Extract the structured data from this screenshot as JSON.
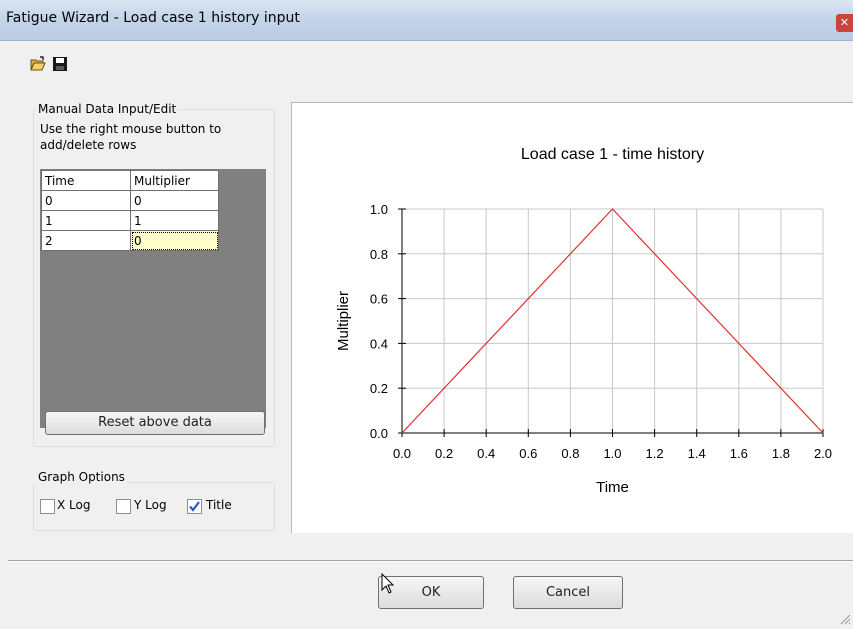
{
  "window": {
    "title": "Fatigue Wizard - Load case 1 history input"
  },
  "toolbar": {
    "icons": [
      "open-folder-icon",
      "save-icon"
    ]
  },
  "manual": {
    "group_label": "Manual Data Input/Edit",
    "hint": "Use the right mouse button to add/delete rows",
    "columns": [
      "Time",
      "Multiplier"
    ],
    "rows": [
      [
        "0",
        "0"
      ],
      [
        "1",
        "1"
      ],
      [
        "2",
        "0"
      ]
    ],
    "reset_label": "Reset above data"
  },
  "graph_options": {
    "group_label": "Graph Options",
    "xlog_label": "X Log",
    "xlog_checked": false,
    "ylog_label": "Y Log",
    "ylog_checked": false,
    "title_label": "Title",
    "title_checked": true
  },
  "chart_data": {
    "type": "line",
    "title": "Load case 1 - time history",
    "xlabel": "Time",
    "ylabel": "Multiplier",
    "xlim": [
      0,
      2
    ],
    "ylim": [
      0,
      1
    ],
    "xticks": [
      "0.0",
      "0.2",
      "0.4",
      "0.6",
      "0.8",
      "1.0",
      "1.2",
      "1.4",
      "1.6",
      "1.8",
      "2.0"
    ],
    "yticks": [
      "0.0",
      "0.2",
      "0.4",
      "0.6",
      "0.8",
      "1.0"
    ],
    "grid": true,
    "series": [
      {
        "x": [
          0,
          1,
          2
        ],
        "y": [
          0,
          1,
          0
        ],
        "color": "#e03030"
      }
    ]
  },
  "buttons": {
    "ok": "OK",
    "cancel": "Cancel"
  }
}
